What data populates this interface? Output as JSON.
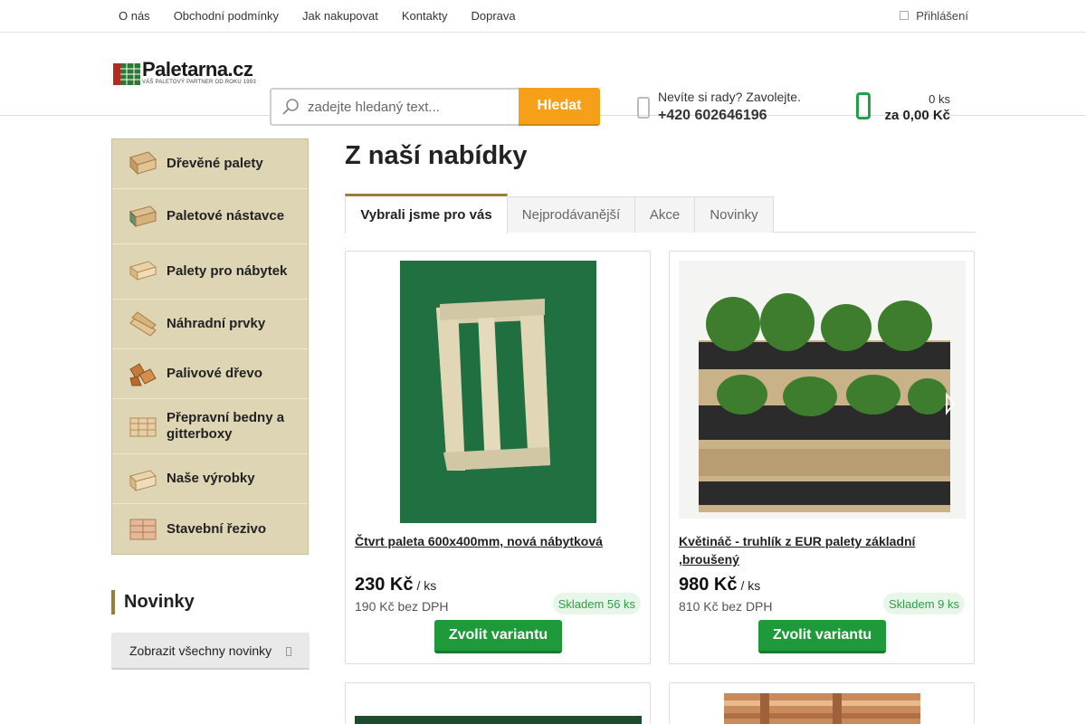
{
  "topbar": {
    "links": [
      "O nás",
      "Obchodní podmínky",
      "Jak nakupovat",
      "Kontakty",
      "Doprava"
    ],
    "login": "Přihlášení"
  },
  "header": {
    "logo_text": "Paletarna.cz",
    "logo_tagline": "VÁŠ PALETOVÝ PARTNER OD ROKU 1993",
    "search": {
      "placeholder": "zadejte hledaný text...",
      "button": "Hledat"
    },
    "contact": {
      "line1": "Nevíte si rady? Zavolejte.",
      "phone": "+420 602646196"
    },
    "cart": {
      "quantity": "0 ks",
      "total": "za 0,00 Kč"
    }
  },
  "sidebar": {
    "categories": [
      {
        "label": "Dřevěné palety",
        "icon": "pallet-icon"
      },
      {
        "label": "Paletové nástavce",
        "icon": "pallet-collar-icon"
      },
      {
        "label": "Palety pro nábytek",
        "icon": "furniture-pallet-icon"
      },
      {
        "label": "Náhradní prvky",
        "icon": "boards-icon"
      },
      {
        "label": "Palivové dřevo",
        "icon": "firewood-icon"
      },
      {
        "label": "Přepravní bedny a gitterboxy",
        "icon": "crate-icon"
      },
      {
        "label": "Naše výrobky",
        "icon": "products-icon"
      },
      {
        "label": "Stavební řezivo",
        "icon": "lumber-icon"
      }
    ],
    "news_heading": "Novinky",
    "show_all": "Zobrazit všechny novinky"
  },
  "main": {
    "title": "Z naší nabídky",
    "tabs": [
      "Vybrali jsme pro vás",
      "Nejprodávanější",
      "Akce",
      "Novinky"
    ],
    "products": [
      {
        "name": "Čtvrt paleta 600x400mm, nová nábytková",
        "price": "230 Kč",
        "unit": "/ ks",
        "price_net": "190 Kč bez DPH",
        "stock": "Skladem 56 ks",
        "button": "Zvolit variantu"
      },
      {
        "name": "Květináč - truhlík z EUR palety základní ,broušený",
        "price": "980 Kč",
        "unit": "/ ks",
        "price_net": "810 Kč bez DPH",
        "stock": "Skladem 9 ks",
        "button": "Zvolit variantu"
      }
    ]
  },
  "colors": {
    "accent_orange": "#f6a01a",
    "buy_green": "#1f9a3a",
    "sidebar_bg": "#ddd5b4",
    "tab_accent": "#9c7b3c"
  }
}
